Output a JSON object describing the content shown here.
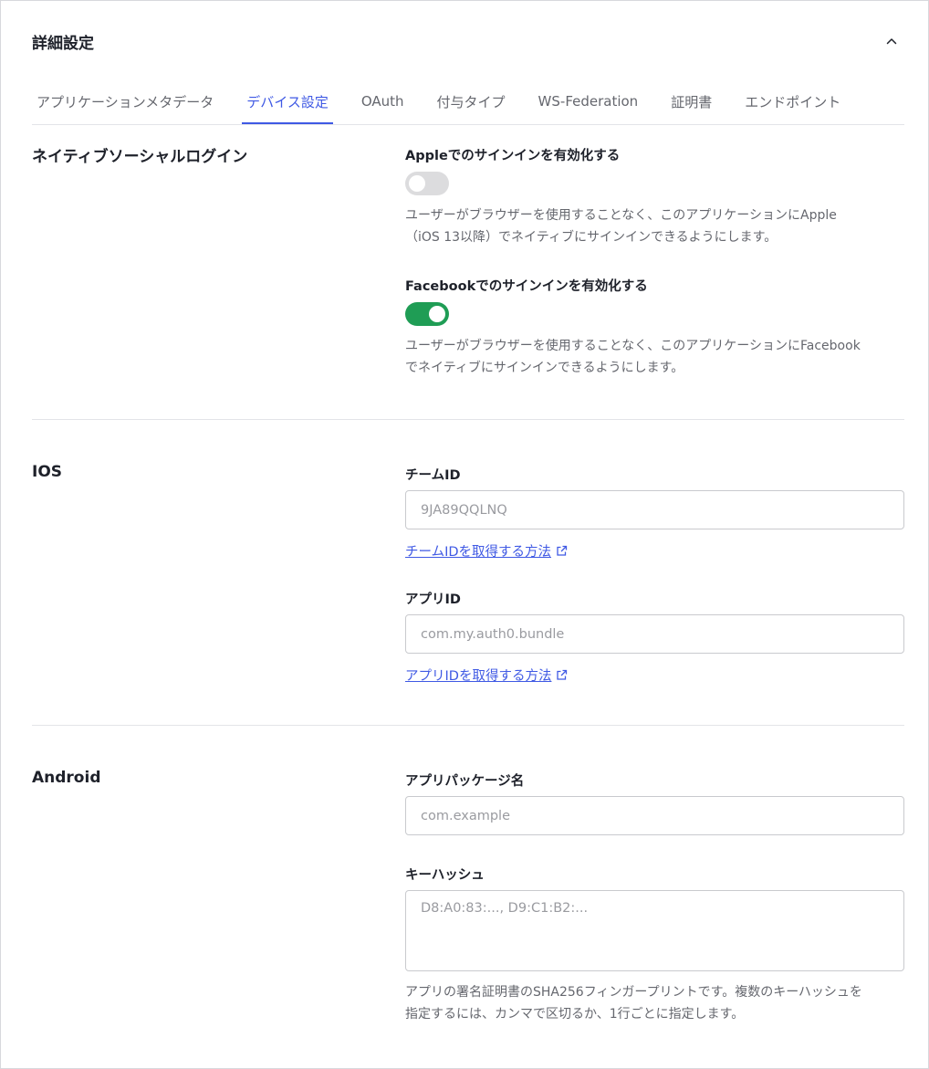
{
  "header": {
    "title": "詳細設定"
  },
  "tabs": [
    {
      "label": "アプリケーションメタデータ"
    },
    {
      "label": "デバイス設定"
    },
    {
      "label": "OAuth"
    },
    {
      "label": "付与タイプ"
    },
    {
      "label": "WS-Federation"
    },
    {
      "label": "証明書"
    },
    {
      "label": "エンドポイント"
    }
  ],
  "social": {
    "title": "ネイティブソーシャルログイン",
    "apple": {
      "label": "Appleでのサインインを有効化する",
      "enabled": false,
      "help_line1": "ユーザーがブラウザーを使用することなく、このアプリケーションにApple",
      "help_line2": "（iOS 13以降）でネイティブにサインインできるようにします。"
    },
    "facebook": {
      "label": "Facebookでのサインインを有効化する",
      "enabled": true,
      "help_line1": "ユーザーがブラウザーを使用することなく、このアプリケーションにFacebook",
      "help_line2": "でネイティブにサインインできるようにします。"
    }
  },
  "ios": {
    "title": "IOS",
    "team_id": {
      "label": "チームID",
      "placeholder": "9JA89QQLNQ",
      "link": "チームIDを取得する方法"
    },
    "app_id": {
      "label": "アプリID",
      "placeholder": "com.my.auth0.bundle",
      "link": "アプリIDを取得する方法"
    }
  },
  "android": {
    "title": "Android",
    "package": {
      "label": "アプリパッケージ名",
      "placeholder": "com.example"
    },
    "key_hash": {
      "label": "キーハッシュ",
      "placeholder": "D8:A0:83:..., D9:C1:B2:...",
      "help_line1": "アプリの署名証明書のSHA256フィンガープリントです。複数のキーハッシュを",
      "help_line2": "指定するには、カンマで区切るか、1行ごとに指定します。"
    }
  },
  "colors": {
    "accent": "#3f59e4",
    "toggle_on": "#1f9d55",
    "toggle_off": "#dcdcde"
  }
}
